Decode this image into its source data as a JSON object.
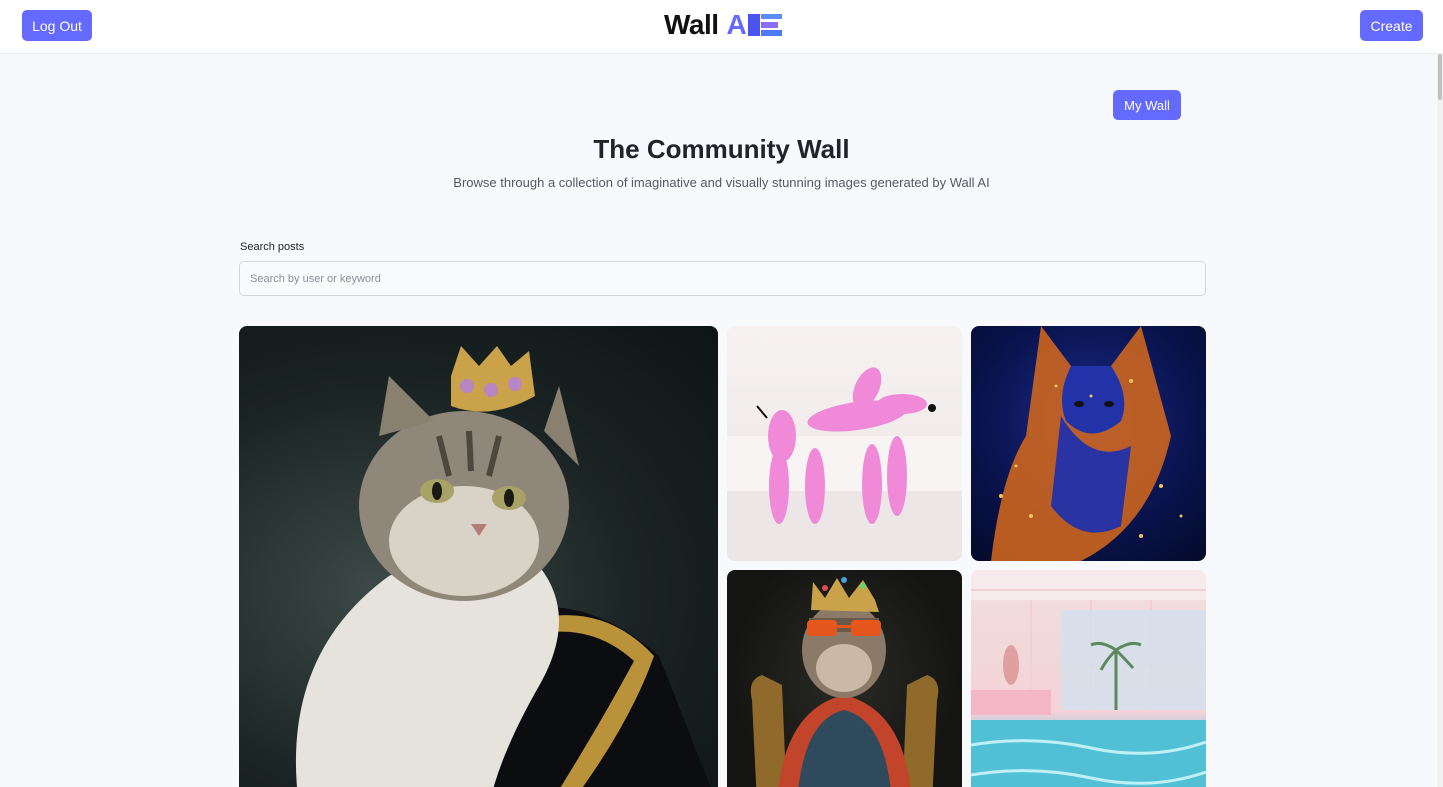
{
  "header": {
    "logout_label": "Log Out",
    "logo_text": "Wall",
    "logo_ai": "AI",
    "create_label": "Create"
  },
  "hero": {
    "my_wall_label": "My Wall",
    "title": "The Community Wall",
    "subtitle": "Browse through a collection of imaginative and visually stunning images generated by Wall AI"
  },
  "search": {
    "label": "Search posts",
    "placeholder": "Search by user or keyword",
    "value": ""
  },
  "gallery": {
    "items": [
      {
        "icon": "crowned-cat-portrait-image"
      },
      {
        "icon": "pink-balloon-dog-image"
      },
      {
        "icon": "cosmic-fox-image"
      },
      {
        "icon": "crowned-monkey-sunglasses-image"
      },
      {
        "icon": "pastel-indoor-pool-image"
      }
    ]
  },
  "colors": {
    "accent": "#6469ff",
    "background": "#f8f9fc",
    "text": "#222328"
  }
}
